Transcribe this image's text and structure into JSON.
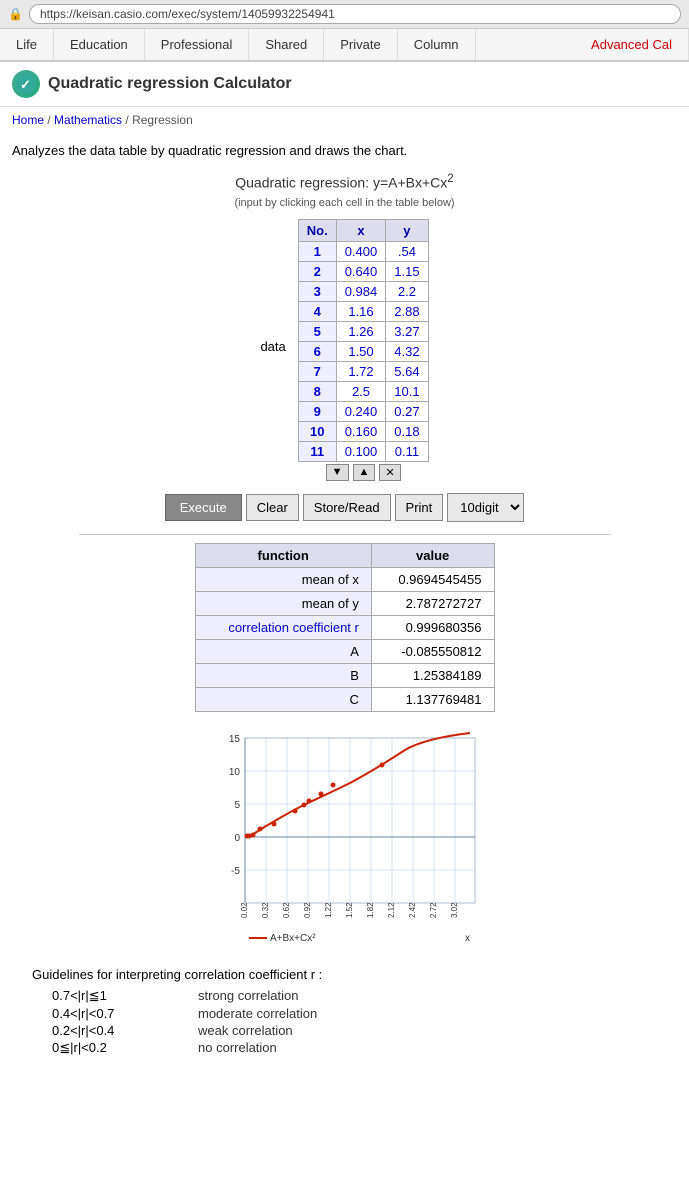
{
  "browser": {
    "url": "https://keisan.casio.com/exec/system/14059932254941"
  },
  "nav": {
    "tabs": [
      {
        "label": "Life",
        "active": false
      },
      {
        "label": "Education",
        "active": false
      },
      {
        "label": "Professional",
        "active": false
      },
      {
        "label": "Shared",
        "active": false
      },
      {
        "label": "Private",
        "active": false
      },
      {
        "label": "Column",
        "active": false
      },
      {
        "label": "Advanced Cal",
        "active": false,
        "special": "advanced"
      }
    ]
  },
  "app": {
    "title": "Quadratic regression Calculator",
    "icon": "✓"
  },
  "breadcrumb": {
    "home": "Home",
    "section": "Mathematics",
    "page": "Regression"
  },
  "description": "Analyzes the data table by quadratic regression and draws the chart.",
  "formula": {
    "title": "Quadratic regression: y=A+Bx+Cx",
    "superscript": "2",
    "hint": "(input by clicking each cell in the table below)"
  },
  "table": {
    "headers": [
      "No.",
      "x",
      "y"
    ],
    "rows": [
      {
        "no": "1",
        "x": "0.400",
        "y": ".54"
      },
      {
        "no": "2",
        "x": "0.640",
        "y": "1.15"
      },
      {
        "no": "3",
        "x": "0.984",
        "y": "2.2"
      },
      {
        "no": "4",
        "x": "1.16",
        "y": "2.88"
      },
      {
        "no": "5",
        "x": "1.26",
        "y": "3.27"
      },
      {
        "no": "6",
        "x": "1.50",
        "y": "4.32"
      },
      {
        "no": "7",
        "x": "1.72",
        "y": "5.64"
      },
      {
        "no": "8",
        "x": "2.5",
        "y": "10.1"
      },
      {
        "no": "9",
        "x": "0.240",
        "y": "0.27"
      },
      {
        "no": "10",
        "x": "0.160",
        "y": "0.18"
      },
      {
        "no": "11",
        "x": "0.100",
        "y": "0.11"
      }
    ],
    "data_label": "data"
  },
  "buttons": {
    "execute": "Execute",
    "clear": "Clear",
    "store_read": "Store/Read",
    "print": "Print",
    "digit": "10digit"
  },
  "results": {
    "headers": [
      "function",
      "value"
    ],
    "rows": [
      {
        "fn": "mean of x",
        "val": "0.9694545455",
        "link": false
      },
      {
        "fn": "mean of y",
        "val": "2.787272727",
        "link": false
      },
      {
        "fn": "correlation coefficient r",
        "val": "0.999680356",
        "link": true
      },
      {
        "fn": "A",
        "val": "-0.085550812",
        "link": false
      },
      {
        "fn": "B",
        "val": "1.25384189",
        "link": false
      },
      {
        "fn": "C",
        "val": "1.137769481",
        "link": false
      }
    ]
  },
  "chart": {
    "y_axis_labels": [
      "15",
      "10",
      "5",
      "0",
      "-5"
    ],
    "x_axis_labels": [
      "0.02",
      "0.32",
      "0.62",
      "0.92",
      "1.22",
      "1.52",
      "1.82",
      "2.12",
      "2.42",
      "2.72",
      "3.02"
    ],
    "legend": "A+Bx+Cx²",
    "x_label": "x"
  },
  "guidelines": {
    "title": "Guidelines for interpreting correlation coefficient r :",
    "rows": [
      {
        "range": "0.7<|r|≦1",
        "desc": "strong correlation"
      },
      {
        "range": "0.4<|r|<0.7",
        "desc": "moderate correlation"
      },
      {
        "range": "0.2<|r|<0.4",
        "desc": "weak correlation"
      },
      {
        "range": "0≦|r|<0.2",
        "desc": "no correlation"
      }
    ]
  }
}
